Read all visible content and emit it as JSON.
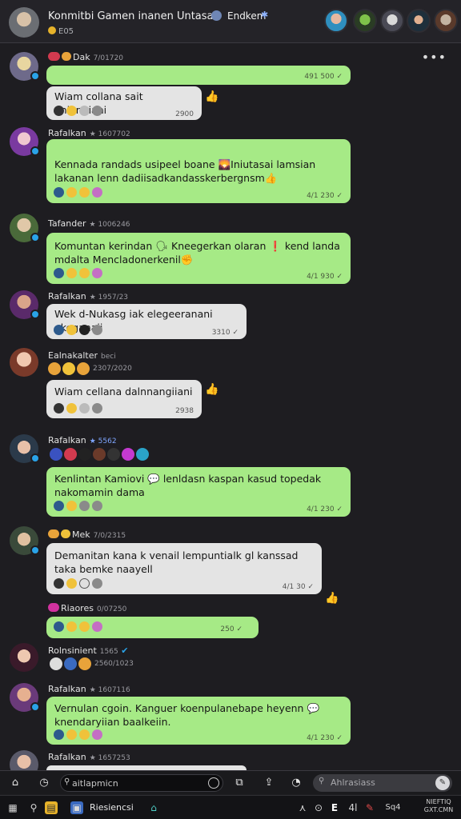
{
  "header": {
    "title": "Konmitbi Gamen inanen Untasan",
    "subtitle": "E05",
    "endlabel": "Endkem",
    "icon_left": "globe-icon",
    "icon_right": "star-icon"
  },
  "messages": [
    {
      "author": "Dak",
      "time": "7/01720",
      "bubble": "green",
      "text": "",
      "meta": "491 500"
    },
    {
      "author": "",
      "time": "",
      "bubble": "white",
      "text": "Wiam collana sait aniangiani",
      "meta": "2900"
    },
    {
      "author": "Rafalkan",
      "time": "1607702",
      "bubble": "green",
      "text": "Kennada randads usipeel boane 🌄Iniutasai lamsian lakanan lenn dadiisadkandasskerbergnsm👍",
      "meta": "4/1 230"
    },
    {
      "author": "Tafander",
      "time": "1006246",
      "bubble": "green",
      "text": "Komuntan kerindan 🗣 Kneegerkan olaran ❗ kend landa mdalta Mencladonerkenil✊",
      "meta": "4/1 930"
    },
    {
      "author": "Rafalkan",
      "time": "1957/23",
      "bubble": "white",
      "text": "Wek d-Nukasg iak elegeeranani ekeganaii",
      "meta": "3310"
    },
    {
      "author": "Ealnakalter",
      "time": "beci",
      "bubble": "white",
      "text": "Wiam cellana dalnnangiiani",
      "meta": "2938",
      "emoji_time": "2307/2020"
    },
    {
      "author": "Rafalkan",
      "time": "5562",
      "bubble": "green",
      "text": "Kenlintan Kamiovi 💬 lenldasn kaspan kasud topedak nakomamin dama",
      "meta": "4/1 230"
    },
    {
      "author": "Mek",
      "time": "7/0/2315",
      "bubble": "white",
      "text": "Demanitan kana k venail lempuntialk gl kanssad taka bemke naayell",
      "meta": "4/1 30"
    },
    {
      "author": "Riaores",
      "time": "0/07250",
      "bubble": "green",
      "text": "",
      "meta": "250"
    },
    {
      "author": "Rolnsinient",
      "time": "1565",
      "bubble": "",
      "text": "",
      "meta": "",
      "emoji_time": "2560/1023"
    },
    {
      "author": "Rafalkan",
      "time": "1607116",
      "bubble": "green",
      "text": "Vernulan cgoin. Kanguer koenpulanebape heyenn 💬 knendaryiian baalkeiin.",
      "meta": "4/1 230"
    },
    {
      "author": "Rafalkan",
      "time": "1657253",
      "bubble": "",
      "text": "",
      "meta": ""
    }
  ],
  "composer": {
    "search_placeholder": "aitlapmicn",
    "search2_placeholder": "Ahlrasiass"
  },
  "taskbar": {
    "app_label": "Riesiencsi",
    "tray_label": "4l",
    "sys_label": "Sq4",
    "clock_line1": "NIEFTIQ",
    "clock_line2": "GXT.CMN"
  },
  "colors": {
    "bubble_green": "#a6ea86",
    "bubble_white": "#e4e4e4",
    "background": "#1e1d21",
    "header": "#242328"
  }
}
